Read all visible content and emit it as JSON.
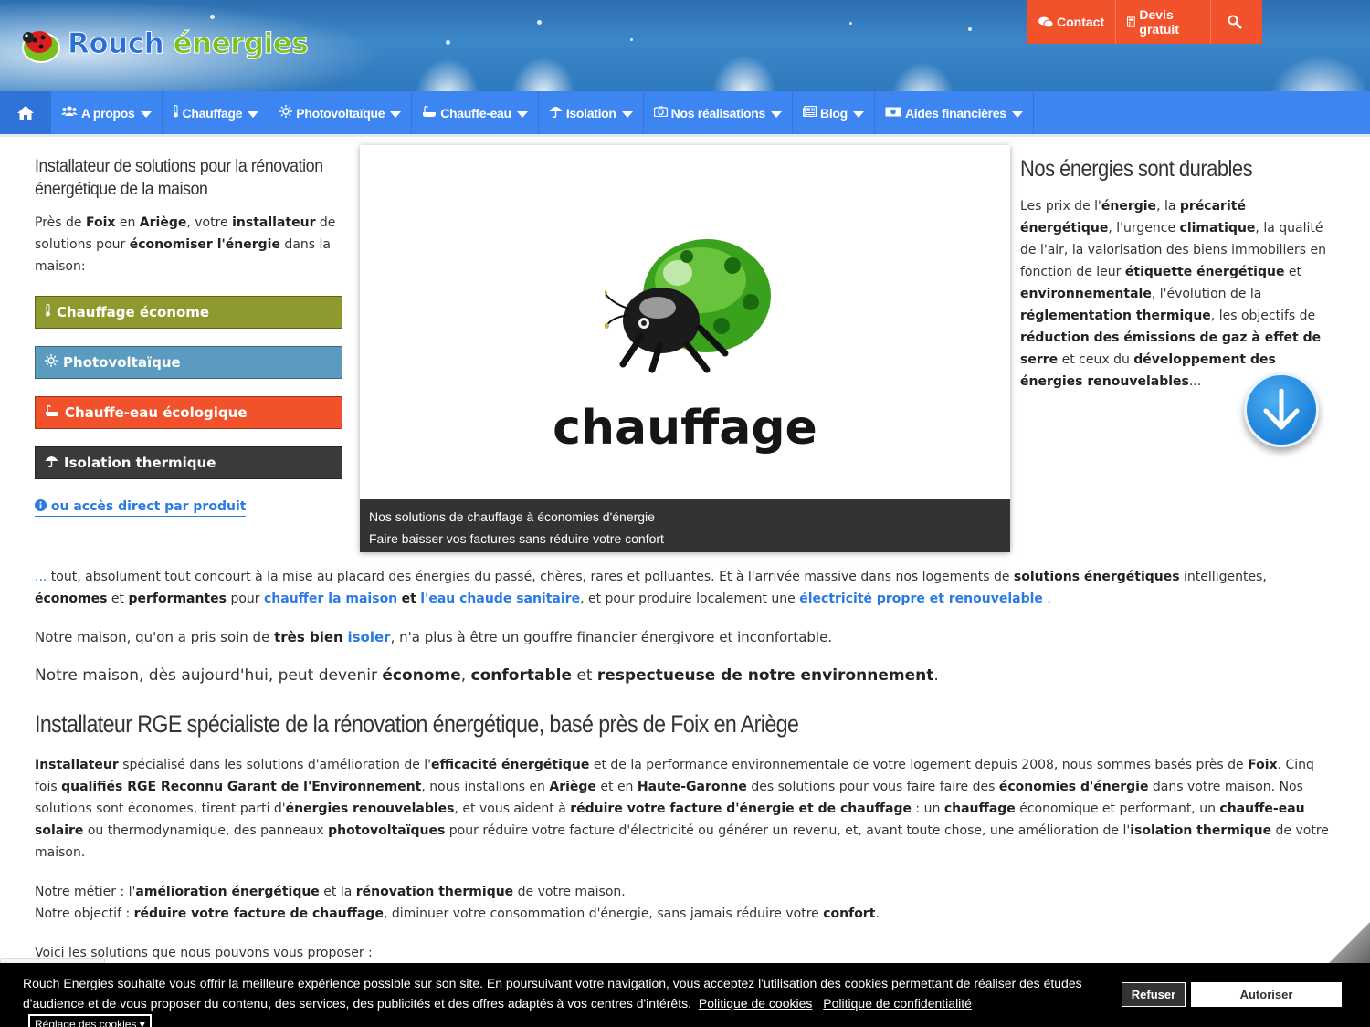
{
  "brand": {
    "word1": "Rouch",
    "word2": "énergies"
  },
  "topbar": {
    "contact": "Contact",
    "devis": "Devis gratuit"
  },
  "nav": {
    "items": [
      {
        "label": "A propos",
        "icon": "users-icon"
      },
      {
        "label": "Chauffage",
        "icon": "thermometer-icon"
      },
      {
        "label": "Photovoltaïque",
        "icon": "sun-icon"
      },
      {
        "label": "Chauffe-eau",
        "icon": "bath-icon"
      },
      {
        "label": "Isolation",
        "icon": "umbrella-icon"
      },
      {
        "label": "Nos réalisations",
        "icon": "camera-icon"
      },
      {
        "label": "Blog",
        "icon": "newspaper-icon"
      },
      {
        "label": "Aides financières",
        "icon": "money-icon"
      }
    ]
  },
  "left": {
    "title": "Installateur de solutions pour la rénovation énergétique de la maison",
    "intro": {
      "t1": "Près de ",
      "b1": "Foix",
      "t2": " en ",
      "b2": "Ariège",
      "t3": ", votre ",
      "b3": "installateur",
      "t4": " de solutions pour ",
      "b4": "économiser l'énergie",
      "t5": " dans la maison:"
    },
    "buttons": [
      {
        "label": "Chauffage économe",
        "color": "#8f9a2e",
        "icon": "thermometer-icon"
      },
      {
        "label": "Photovoltaïque",
        "color": "#5b9bbf",
        "icon": "sun-icon"
      },
      {
        "label": "Chauffe-eau écologique",
        "color": "#f2522b",
        "icon": "bath-icon"
      },
      {
        "label": "Isolation thermique",
        "color": "#3a3a3a",
        "icon": "umbrella-icon"
      }
    ],
    "direct_link": "ou accès direct par produit"
  },
  "slider": {
    "word": "chauffage",
    "caption1": "Nos solutions de chauffage à économies d'énergie",
    "caption2": "Faire baisser vos factures sans réduire votre confort"
  },
  "right": {
    "title": "Nos énergies sont durables",
    "p": {
      "t1": "Les prix de l'",
      "b1": "énergie",
      "t2": ", la ",
      "b2": "précarité énergétique",
      "t3": ", l'urgence ",
      "b3": "climatique",
      "t4": ", la qualité de l'air, la valorisation des biens immobiliers en fonction de leur ",
      "b4": "étiquette énergétique",
      "t5": " et ",
      "b5": "environnementale",
      "t6": ", l'évolution de la ",
      "b6": "réglementation thermique",
      "t7": ", les objectifs de ",
      "b7": "réduction des émissions de gaz à effet de serre",
      "t8": " et ceux du ",
      "b8": "développement des énergies renouvelables",
      "t9": "..."
    }
  },
  "main": {
    "p1": {
      "link0": "...",
      "t1": " tout, absolument tout concourt à la mise au placard des énergies du passé, chères, rares et polluantes. Et à l'arrivée massive dans nos logements de ",
      "b1": "solutions énergétiques",
      "t2": " intelligentes, ",
      "b2": "économes",
      "t3": " et ",
      "b3": "performantes",
      "t4": " pour ",
      "l1": "chauffer la maison",
      "t5": " ",
      "b4": "et",
      "t6": " ",
      "l2": "l'eau chaude sanitaire",
      "t7": ", et pour produire localement une ",
      "l3": "électricité propre et renouvelable",
      "t8": " ."
    },
    "p2": {
      "t1": "Notre maison, qu'on a pris soin de ",
      "b1": "très bien",
      "t2": " ",
      "l1": "isoler",
      "t3": ", n'a plus à être un gouffre financier énergivore et inconfortable."
    },
    "p3": {
      "t1": "Notre maison, dès aujourd'hui, peut devenir ",
      "b1": "économe",
      "t2": ", ",
      "b2": "confortable",
      "t3": " et ",
      "b3": "respectueuse de notre environnement",
      "t4": "."
    },
    "h2": "Installateur RGE spécialiste de la rénovation énergétique, basé près de Foix en Ariège",
    "p4": {
      "b1": "Installateur",
      "t1": " spécialisé dans les solutions d'amélioration de l'",
      "b2": "efficacité énergétique",
      "t2": " et de la performance environnementale de votre logement depuis 2008, nous sommes basés près de ",
      "b3": "Foix",
      "t3": ". Cinq fois ",
      "b4": "qualifiés RGE Reconnu Garant de l'Environnement",
      "t4": ", nous installons en ",
      "b5": "Ariège",
      "t5": " et en ",
      "b6": "Haute-Garonne",
      "t6": " des solutions pour vous faire faire des ",
      "b7": "économies d'énergie",
      "t7": " dans votre maison. Nos solutions sont économes, tirent parti d'",
      "b8": "énergies renouvelables",
      "t8": ", et vous aident à ",
      "b9": "réduire votre facture d'énergie et de chauffage",
      "t9": " : un ",
      "b10": "chauffage",
      "t10": " économique et performant, un ",
      "b11": "chauffe-eau solaire",
      "t11": " ou thermodynamique, des panneaux ",
      "b12": "photovoltaïques",
      "t12": " pour réduire votre facture d'électricité ou générer un revenu, et, avant toute chose, une amélioration de l'",
      "b13": "isolation thermique",
      "t13": " de votre maison."
    },
    "p5": {
      "t1": "Notre métier : l'",
      "b1": "amélioration énergétique",
      "t2": " et la ",
      "b2": "rénovation thermique",
      "t3": " de votre maison.",
      "t4": "Notre objectif : ",
      "b3": "réduire votre facture de chauffage",
      "t5": ", diminuer votre consommation d'énergie, sans jamais réduire votre ",
      "b4": "confort",
      "t6": "."
    },
    "p6": "Voici les solutions que nous pouvons vous proposer :"
  },
  "cookie": {
    "text": "Rouch Energies souhaite vous offrir la meilleure expérience possible sur son site. En poursuivant votre navigation, vous acceptez l'utilisation des cookies permettant de réaliser des études d'audience et de vous proposer du contenu, des services, des publicités et des offres adaptés à vos centres d'intérêts.",
    "link1": "Politique de cookies",
    "link2": "Politique de confidentialité",
    "settings": "Réglage des cookies",
    "refuse": "Refuser",
    "accept": "Autoriser"
  }
}
